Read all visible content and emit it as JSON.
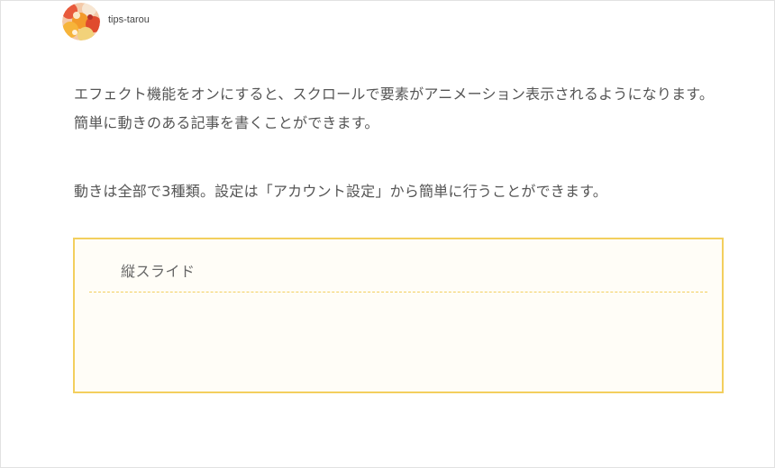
{
  "author": {
    "name": "tips-tarou",
    "avatar_icon": "user-avatar-icon"
  },
  "article": {
    "paragraphs": [
      "エフェクト機能をオンにすると、スクロールで要素がアニメーション表示されるようになります。簡単に動きのある記事を書くことができます。",
      "動きは全部で3種類。設定は「アカウント設定」から簡単に行うことができます。"
    ]
  },
  "box": {
    "title": "縦スライド",
    "border_color": "#f3cf5e",
    "background_color": "#fffdf7"
  }
}
